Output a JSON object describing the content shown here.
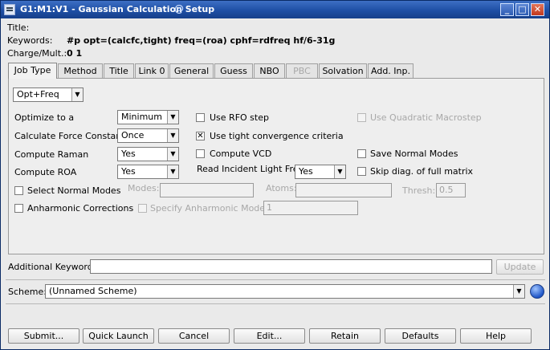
{
  "window": {
    "title": "G1:M1:V1 - Gaussian Calculation Setup",
    "controls": {
      "minimize": "_",
      "maximize": "□",
      "close": "✕"
    }
  },
  "header": {
    "title_label": "Title:",
    "title_value": "",
    "keywords_label": "Keywords:",
    "keywords_value": "#p opt=(calcfc,tight) freq=(roa) cphf=rdfreq hf/6-31g",
    "charge_label": "Charge/Mult.:",
    "charge_value": "0 1"
  },
  "tabs": [
    {
      "label": "Job Type",
      "state": "active"
    },
    {
      "label": "Method",
      "state": "normal"
    },
    {
      "label": "Title",
      "state": "normal"
    },
    {
      "label": "Link 0",
      "state": "normal"
    },
    {
      "label": "General",
      "state": "normal"
    },
    {
      "label": "Guess",
      "state": "normal"
    },
    {
      "label": "NBO",
      "state": "normal"
    },
    {
      "label": "PBC",
      "state": "disabled"
    },
    {
      "label": "Solvation",
      "state": "normal"
    },
    {
      "label": "Add. Inp.",
      "state": "normal"
    }
  ],
  "job": {
    "job_type": "Opt+Freq",
    "optimize_label": "Optimize to a",
    "optimize_value": "Minimum",
    "force_label": "Calculate Force Constants",
    "force_value": "Once",
    "raman_label": "Compute Raman",
    "raman_value": "Yes",
    "roa_label": "Compute ROA",
    "roa_value": "Yes",
    "rfo_label": "Use RFO step",
    "rfo_checked": false,
    "tight_label": "Use tight convergence criteria",
    "tight_checked": true,
    "vcd_label": "Compute VCD",
    "vcd_checked": false,
    "incident_label": "Read Incident Light Freqs",
    "incident_value": "Yes",
    "quad_label": "Use Quadratic Macrostep",
    "quad_checked": false,
    "save_modes_label": "Save Normal Modes",
    "save_modes_checked": false,
    "skip_diag_label": "Skip diag. of full matrix",
    "skip_diag_checked": false,
    "select_modes_label": "Select Normal Modes",
    "select_modes_checked": false,
    "modes_label": "Modes:",
    "modes_value": "",
    "atoms_label": "Atoms:",
    "atoms_value": "",
    "thresh_label": "Thresh:",
    "thresh_value": "0.5",
    "anharm_label": "Anharmonic Corrections",
    "anharm_checked": false,
    "spec_anharm_label": "Specify Anharmonic Modes:",
    "spec_anharm_checked": false,
    "spec_anharm_value": "1"
  },
  "additional": {
    "label": "Additional Keywords:",
    "value": "",
    "update_label": "Update"
  },
  "scheme": {
    "label": "Scheme:",
    "value": "(Unnamed Scheme)"
  },
  "footer": {
    "submit": "Submit...",
    "quick": "Quick Launch",
    "cancel": "Cancel",
    "edit": "Edit...",
    "retain": "Retain",
    "defaults": "Defaults",
    "help": "Help"
  },
  "colors": {
    "titlebar": "#1e4fa5",
    "background": "#eaeaea"
  }
}
